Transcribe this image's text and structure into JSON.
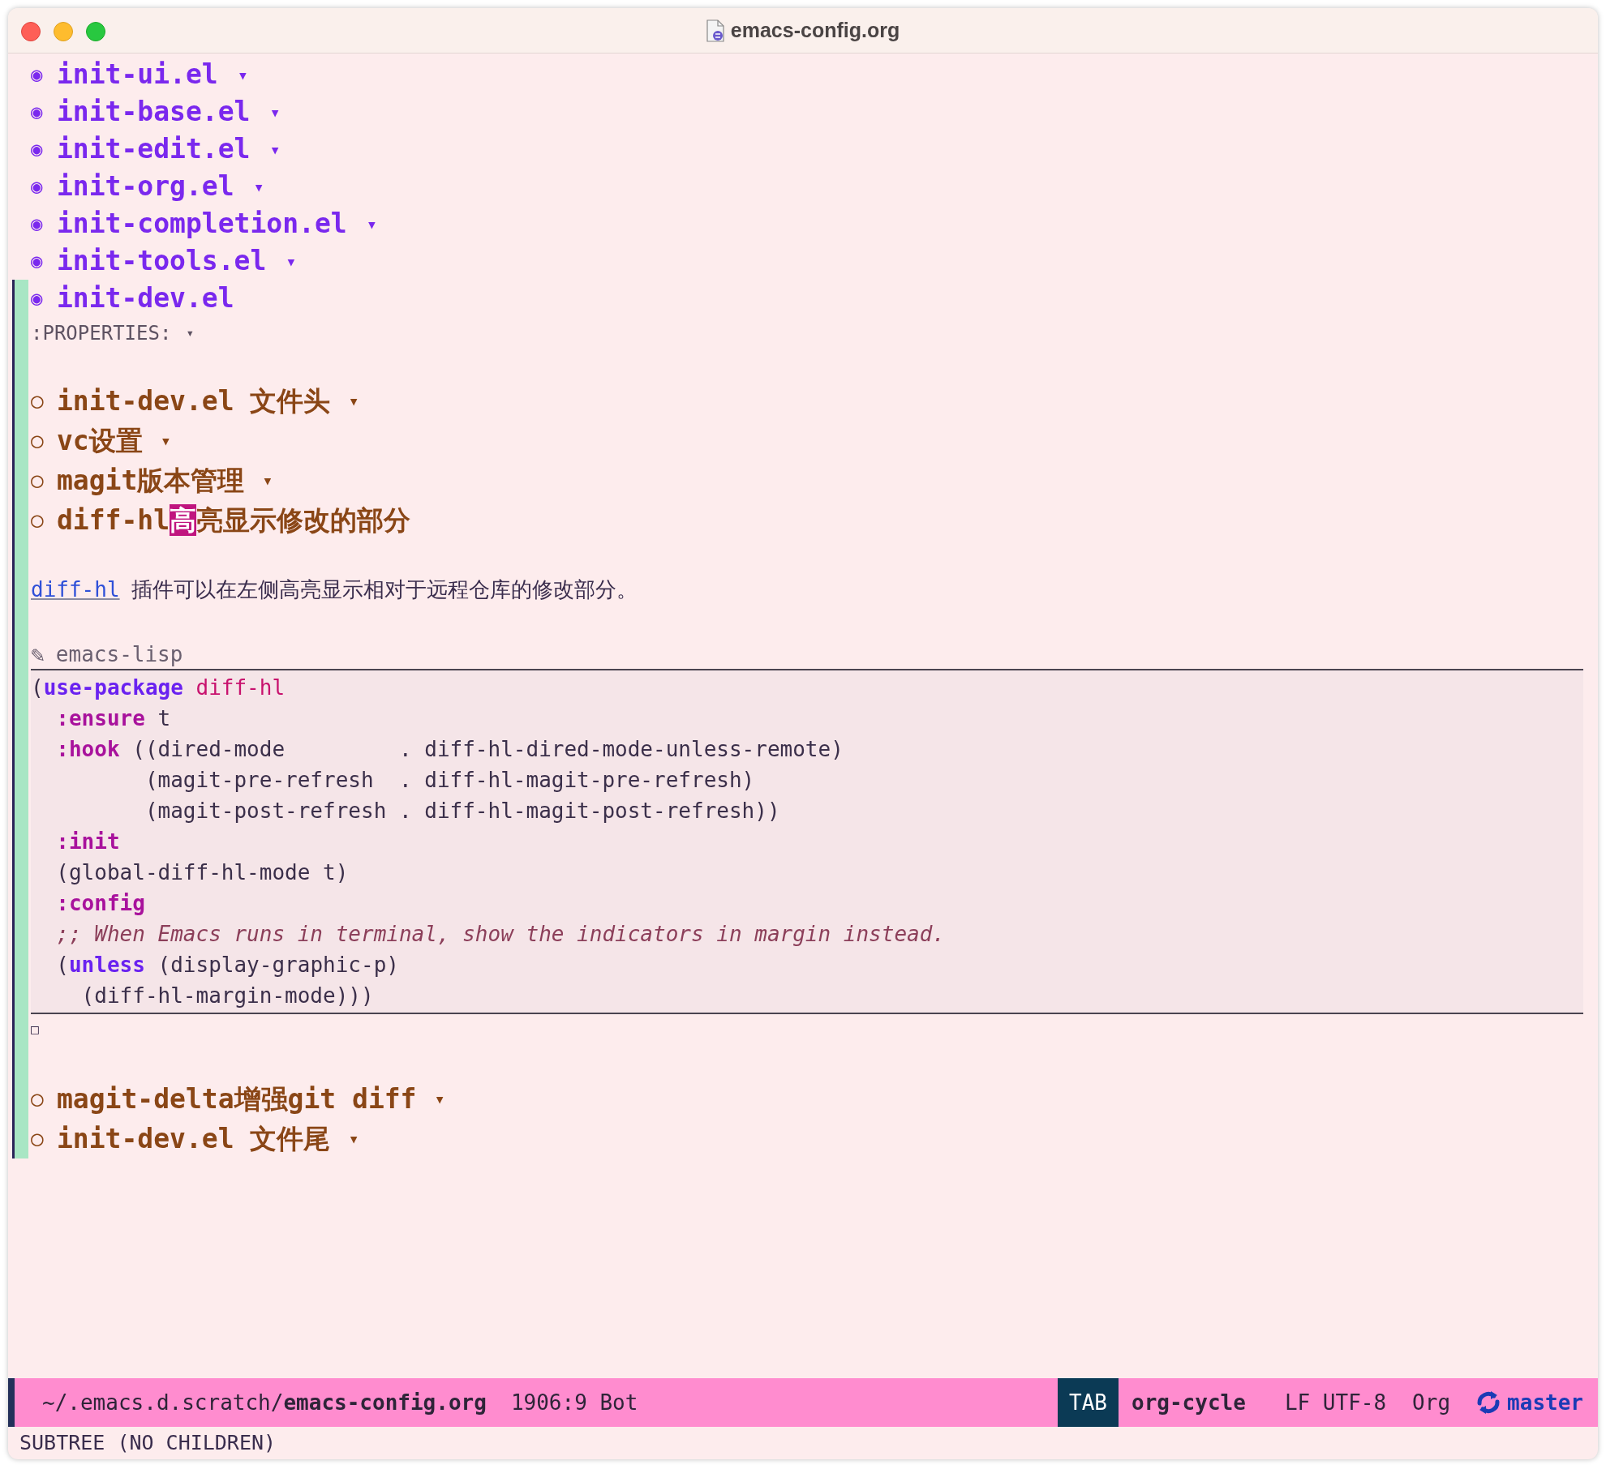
{
  "window": {
    "title": "emacs-config.org"
  },
  "outline": [
    {
      "bullet": "◉",
      "title": "init-ui.el",
      "marker": "▾"
    },
    {
      "bullet": "◉",
      "title": "init-base.el",
      "marker": "▾"
    },
    {
      "bullet": "◉",
      "title": "init-edit.el",
      "marker": "▾"
    },
    {
      "bullet": "◉",
      "title": "init-org.el",
      "marker": "▾"
    },
    {
      "bullet": "◉",
      "title": "init-completion.el",
      "marker": "▾"
    },
    {
      "bullet": "◉",
      "title": "init-tools.el",
      "marker": "▾"
    },
    {
      "bullet": "◉",
      "title": "init-dev.el",
      "drawer": {
        "text": ":PROPERTIES:",
        "marker": "▾"
      },
      "children": [
        {
          "bullet": "○",
          "title_parts": [
            {
              "text": "init-dev.el 文件头",
              "cursor": false
            }
          ],
          "marker": "▾"
        },
        {
          "bullet": "○",
          "title_parts": [
            {
              "text": "vc设置",
              "cursor": false
            }
          ],
          "marker": "▾"
        },
        {
          "bullet": "○",
          "title_parts": [
            {
              "text": "magit版本管理",
              "cursor": false
            }
          ],
          "marker": "▾"
        },
        {
          "bullet": "○",
          "title_parts": [
            {
              "text": "diff-hl",
              "cursor": false
            },
            {
              "text": "高",
              "cursor": true
            },
            {
              "text": "亮显示修改的部分",
              "cursor": false
            }
          ],
          "body": [
            {
              "kind": "paragraph",
              "link": "diff-hl",
              "text": "插件可以在左侧高亮显示相对于远程仓库的修改部分。"
            },
            {
              "kind": "src_block",
              "icon": "✎",
              "language": "emacs-lisp",
              "lines": [
                [
                  {
                    "kind": "plain",
                    "text": "("
                  },
                  {
                    "kind": "keyword",
                    "text": "use-package"
                  },
                  {
                    "kind": "package",
                    "text": " diff-hl"
                  }
                ],
                [
                  {
                    "kind": "property",
                    "text": "  :ensure"
                  },
                  {
                    "kind": "plain",
                    "text": " t"
                  }
                ],
                [
                  {
                    "kind": "property",
                    "text": "  :hook"
                  },
                  {
                    "kind": "plain",
                    "text": " ((dired-mode         . diff-hl-dired-mode-unless-remote)"
                  }
                ],
                [
                  {
                    "kind": "plain",
                    "text": "         (magit-pre-refresh  . diff-hl-magit-pre-refresh)"
                  }
                ],
                [
                  {
                    "kind": "plain",
                    "text": "         (magit-post-refresh . diff-hl-magit-post-refresh))"
                  }
                ],
                [
                  {
                    "kind": "property",
                    "text": "  :init"
                  }
                ],
                [
                  {
                    "kind": "plain",
                    "text": "  (global-diff-hl-mode t)"
                  }
                ],
                [
                  {
                    "kind": "property",
                    "text": "  :config"
                  }
                ],
                [
                  {
                    "kind": "comment",
                    "text": "  ;; When Emacs runs in terminal, show the indicators in margin instead."
                  }
                ],
                [
                  {
                    "kind": "plain",
                    "text": "  ("
                  },
                  {
                    "kind": "keyword",
                    "text": "unless"
                  },
                  {
                    "kind": "plain",
                    "text": " (display-graphic-p)"
                  }
                ],
                [
                  {
                    "kind": "plain",
                    "text": "    (diff-hl-margin-mode)))"
                  }
                ]
              ]
            },
            {
              "kind": "mark",
              "text": "□"
            }
          ]
        },
        {
          "bullet": "○",
          "title_parts": [
            {
              "text": "magit-delta增强git diff",
              "cursor": false
            }
          ],
          "marker": "▾"
        },
        {
          "bullet": "○",
          "title_parts": [
            {
              "text": "init-dev.el 文件尾",
              "cursor": false
            }
          ],
          "marker": "▾"
        }
      ]
    }
  ],
  "mode_line": {
    "path": "~/.emacs.d.scratch/**emacs-config.org**",
    "position": "1906:9 Bot",
    "key": "TAB",
    "command": "org-cycle",
    "encoding": "LF UTF-8",
    "mode": "Org",
    "branch": "master"
  },
  "echo_area": "SUBTREE (NO CHILDREN)"
}
